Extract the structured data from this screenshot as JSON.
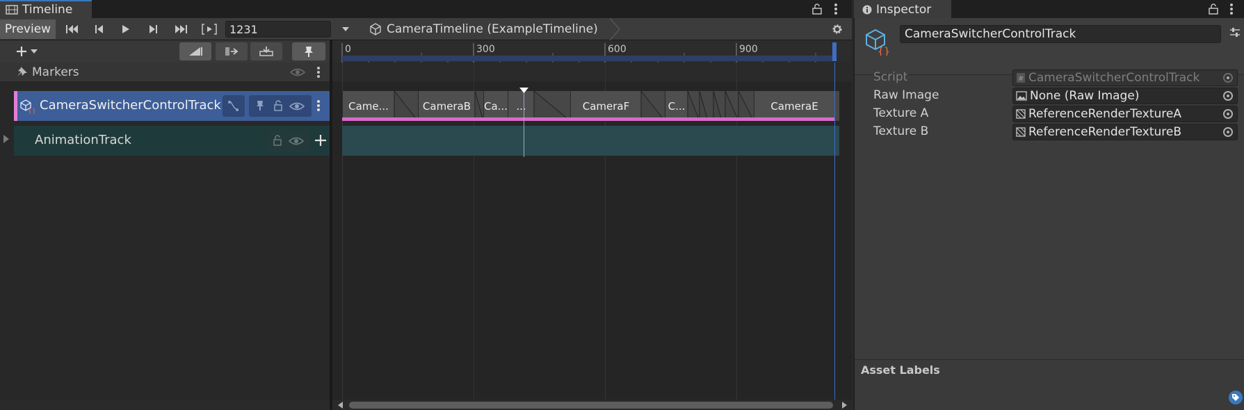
{
  "timeline_tab": {
    "title": "Timeline"
  },
  "inspector_tab": {
    "title": "Inspector"
  },
  "toolbar": {
    "preview_label": "Preview",
    "frame_value": "1231",
    "breadcrumb": "CameraTimeline (ExampleTimeline)"
  },
  "ruler": {
    "ticks": [
      "0",
      "300",
      "600",
      "900"
    ]
  },
  "tracks": {
    "markers_label": "Markers",
    "camera_track_label": "CameraSwitcherControlTrack",
    "animation_track_label": "AnimationTrack"
  },
  "clips": [
    "Came...",
    "CameraB",
    "Ca...",
    "...",
    "CameraF",
    "C...",
    "CameraE"
  ],
  "inspector": {
    "object_name": "CameraSwitcherControlTrack",
    "properties": [
      {
        "label": "Script",
        "value": "CameraSwitcherControlTrack"
      },
      {
        "label": "Raw Image",
        "value": "None (Raw Image)"
      },
      {
        "label": "Texture A",
        "value": "ReferenceRenderTextureA"
      },
      {
        "label": "Texture B",
        "value": "ReferenceRenderTextureB"
      }
    ],
    "asset_labels": "Asset Labels"
  },
  "colors": {
    "track_selected": "#3d5e98",
    "track_accent": "#e27ed6",
    "animation_track": "#1f3a3b",
    "tab_accent": "#3a79bb"
  }
}
